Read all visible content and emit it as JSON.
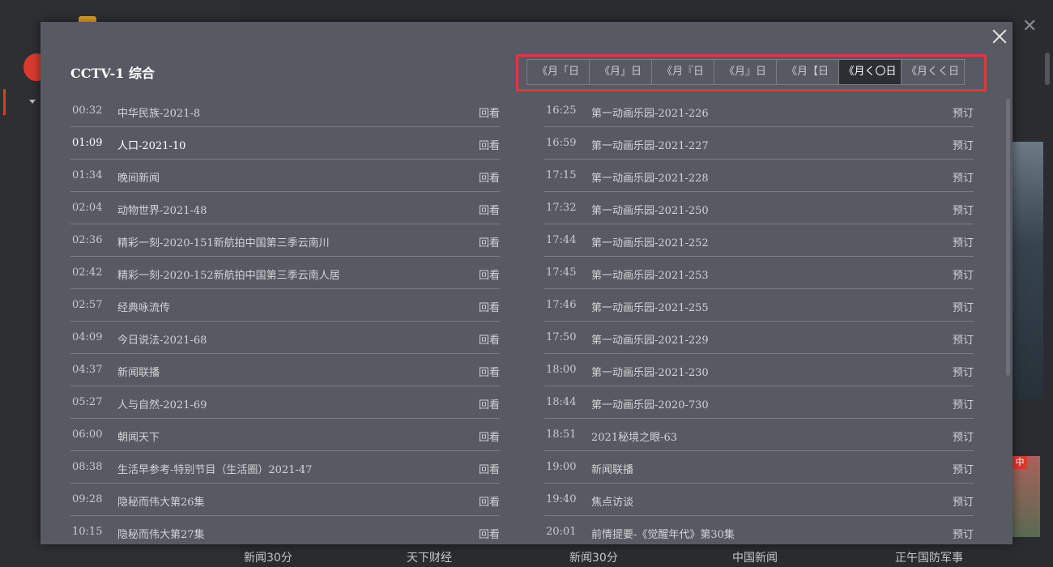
{
  "modal": {
    "channel_title": "CCTV-1 综合",
    "tabs": [
      {
        "label": "《月「日",
        "active": false
      },
      {
        "label": "《月」日",
        "active": false
      },
      {
        "label": "《月『日",
        "active": false
      },
      {
        "label": "《月』日",
        "active": false
      },
      {
        "label": "《月【日",
        "active": false
      },
      {
        "label": "《月く〇日",
        "active": true
      },
      {
        "label": "《月くく日",
        "active": false
      }
    ],
    "left_programs": [
      {
        "time": "00:32",
        "title": "中华民族-2021-8",
        "action": "回看"
      },
      {
        "time": "01:09",
        "title": "人口-2021-10",
        "action": "回看",
        "current": true
      },
      {
        "time": "01:34",
        "title": "晚间新闻",
        "action": "回看"
      },
      {
        "time": "02:04",
        "title": "动物世界-2021-48",
        "action": "回看"
      },
      {
        "time": "02:36",
        "title": "精彩一刻-2020-151新航拍中国第三季云南川",
        "action": "回看"
      },
      {
        "time": "02:42",
        "title": "精彩一刻-2020-152新航拍中国第三季云南人居",
        "action": "回看"
      },
      {
        "time": "02:57",
        "title": "经典咏流传",
        "action": "回看"
      },
      {
        "time": "04:09",
        "title": "今日说法-2021-68",
        "action": "回看"
      },
      {
        "time": "04:37",
        "title": "新闻联播",
        "action": "回看"
      },
      {
        "time": "05:27",
        "title": "人与自然-2021-69",
        "action": "回看"
      },
      {
        "time": "06:00",
        "title": "朝闻天下",
        "action": "回看"
      },
      {
        "time": "08:38",
        "title": "生活早参考-特别节目（生活圈）2021-47",
        "action": "回看"
      },
      {
        "time": "09:28",
        "title": "隐秘而伟大第26集",
        "action": "回看"
      },
      {
        "time": "10:15",
        "title": "隐秘而伟大第27集",
        "action": "回看"
      }
    ],
    "right_programs": [
      {
        "time": "16:25",
        "title": "第一动画乐园-2021-226",
        "action": "预订"
      },
      {
        "time": "16:59",
        "title": "第一动画乐园-2021-227",
        "action": "预订"
      },
      {
        "time": "17:15",
        "title": "第一动画乐园-2021-228",
        "action": "预订"
      },
      {
        "time": "17:32",
        "title": "第一动画乐园-2021-250",
        "action": "预订"
      },
      {
        "time": "17:44",
        "title": "第一动画乐园-2021-252",
        "action": "预订"
      },
      {
        "time": "17:45",
        "title": "第一动画乐园-2021-253",
        "action": "预订"
      },
      {
        "time": "17:46",
        "title": "第一动画乐园-2021-255",
        "action": "预订"
      },
      {
        "time": "17:50",
        "title": "第一动画乐园-2021-229",
        "action": "预订"
      },
      {
        "time": "18:00",
        "title": "第一动画乐园-2021-230",
        "action": "预订"
      },
      {
        "time": "18:44",
        "title": "第一动画乐园-2020-730",
        "action": "预订"
      },
      {
        "time": "18:51",
        "title": "2021秘境之眼-63",
        "action": "预订"
      },
      {
        "time": "19:00",
        "title": "新闻联播",
        "action": "预订"
      },
      {
        "time": "19:40",
        "title": "焦点访谈",
        "action": "预订"
      },
      {
        "time": "20:01",
        "title": "前情提要-《觉醒年代》第30集",
        "action": "预订"
      }
    ]
  },
  "background": {
    "bottom_links": [
      "新闻30分",
      "天下财经",
      "新闻30分",
      "中国新闻",
      "正午国防军事"
    ],
    "thumb_badge": "中"
  },
  "colors": {
    "modal_bg": "#585a63",
    "active_tab_bg": "#2d2e33",
    "highlight_border": "#e8343a"
  }
}
